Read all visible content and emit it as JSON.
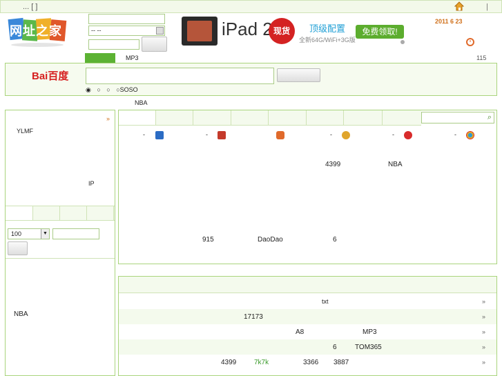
{
  "topbar": {
    "left_text": "... [  ]",
    "divider": "|"
  },
  "logo": {
    "text": "网址之家"
  },
  "login": {
    "select_value": "--    --"
  },
  "ad": {
    "product": "iPad 2",
    "badge": "现货",
    "headline": "顶级配置",
    "sub": "全新64G/WiFi+3G版",
    "cta": "免费领取!"
  },
  "date": "2011  6  23",
  "search_tabs": {
    "active": "",
    "mp3": "MP3",
    "count": "115"
  },
  "search": {
    "brand": "Bai百度",
    "radios": [
      "",
      "",
      "",
      "SOSO"
    ],
    "hot": "NBA"
  },
  "left": {
    "top_more": "»",
    "ylmf": "YLMF",
    "ip": "IP",
    "unit_value": "100",
    "nba": "NBA"
  },
  "icons_row": [
    {
      "dash": "-",
      "icon": "qq-icon",
      "color": "#2b6cc4"
    },
    {
      "dash": "-",
      "icon": "camera-icon",
      "color": "#c43a2b"
    },
    {
      "dash": "",
      "icon": "game-icon",
      "color": "#e06a2b"
    },
    {
      "dash": "-",
      "icon": "star-icon",
      "color": "#e0a52b"
    },
    {
      "dash": "-",
      "icon": "weibo-icon",
      "color": "#d82b2b"
    },
    {
      "dash": "-",
      "icon": "chrome-icon",
      "color": "#2b9ad8"
    }
  ],
  "main_links": {
    "row1": [
      "4399",
      "NBA"
    ],
    "row2": [
      "915",
      "DaoDao",
      "6"
    ]
  },
  "list": [
    {
      "items": [
        "txt"
      ],
      "more": "»"
    },
    {
      "items": [
        "17173"
      ],
      "more": "»"
    },
    {
      "items": [
        "A8",
        "MP3"
      ],
      "more": "»"
    },
    {
      "items": [
        "6",
        "TOM365"
      ],
      "more": "»"
    },
    {
      "items": [
        "4399",
        "7k7k",
        "3366",
        "3887"
      ],
      "more": "»"
    }
  ]
}
